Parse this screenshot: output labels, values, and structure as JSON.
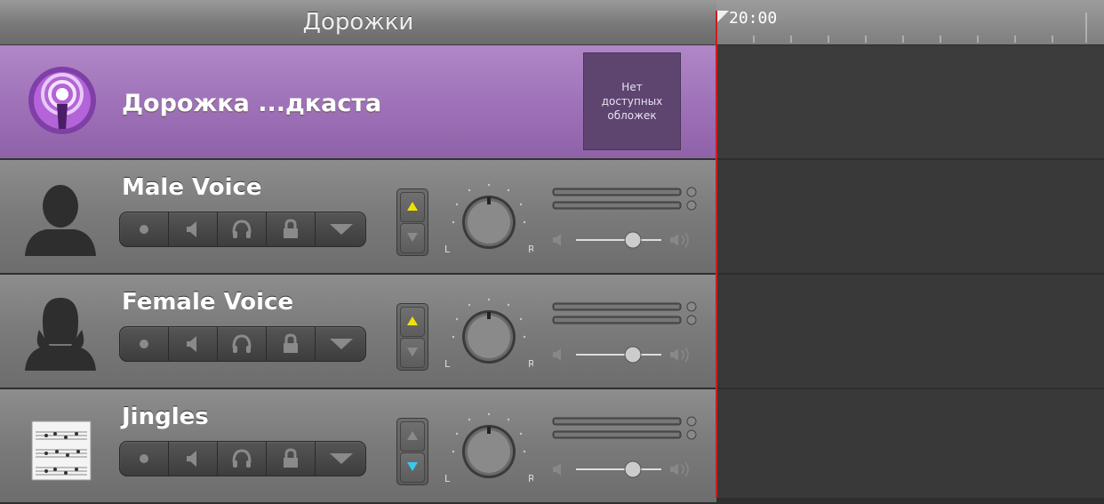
{
  "header": {
    "title": "Дорожки"
  },
  "timeline": {
    "ruler_start": "20:00"
  },
  "podcast_track": {
    "title": "Дорожка ...дкаста",
    "artwork_lines": [
      "Нет",
      "доступных",
      "обложек"
    ],
    "icon": "podcast-icon"
  },
  "tracks": [
    {
      "name": "Male Voice",
      "icon": "male-silhouette-icon",
      "arrow_active": "up",
      "arrow_color": "#f2e200"
    },
    {
      "name": "Female Voice",
      "icon": "female-silhouette-icon",
      "arrow_active": "up",
      "arrow_color": "#f2e200"
    },
    {
      "name": "Jingles",
      "icon": "sheet-music-icon",
      "arrow_active": "down",
      "arrow_color": "#3ac8f0"
    }
  ],
  "controls": [
    "record-icon",
    "mute-icon",
    "headphones-icon",
    "lock-icon",
    "expand-arrow-icon"
  ],
  "pan": {
    "left_label": "L",
    "right_label": "R"
  },
  "colors": {
    "podcast_purple": "#9c6fb6",
    "playhead": "#d01c1c"
  }
}
